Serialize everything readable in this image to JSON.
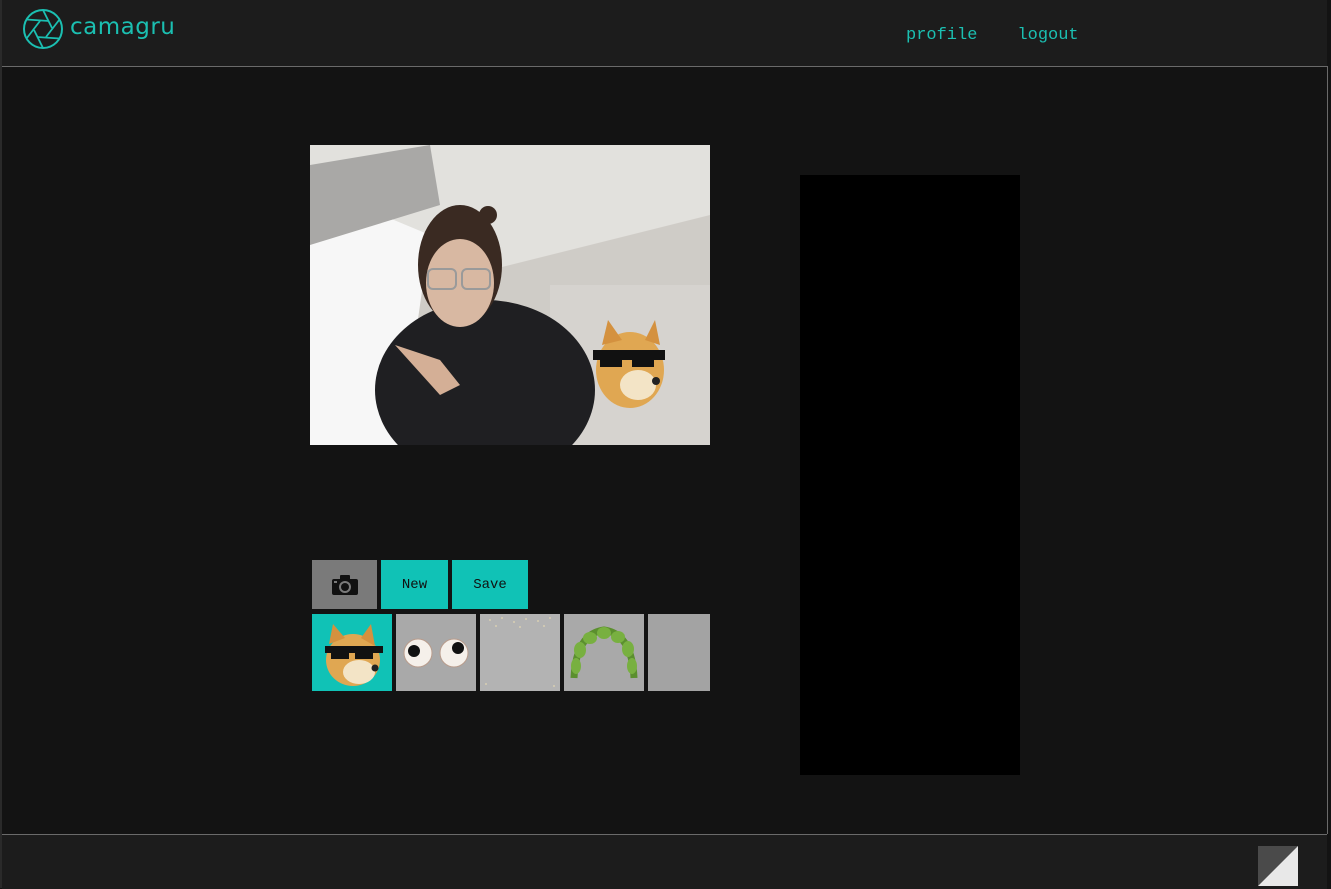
{
  "header": {
    "brand": "camagru",
    "nav": {
      "profile_label": "profile",
      "logout_label": "logout"
    }
  },
  "colors": {
    "accent": "#1bbfb1",
    "button_accent": "#10c2b6",
    "header_bg": "#1c1c1c",
    "page_bg": "#131313"
  },
  "editor": {
    "buttons": {
      "capture_icon": "camera-icon",
      "new_label": "New",
      "save_label": "Save"
    },
    "stickers": [
      {
        "name": "doge-sunglasses",
        "selected": true
      },
      {
        "name": "googly-eyes",
        "selected": false
      },
      {
        "name": "glitter",
        "selected": false
      },
      {
        "name": "leaf-crown",
        "selected": false
      },
      {
        "name": "grey-texture",
        "selected": false
      }
    ]
  }
}
